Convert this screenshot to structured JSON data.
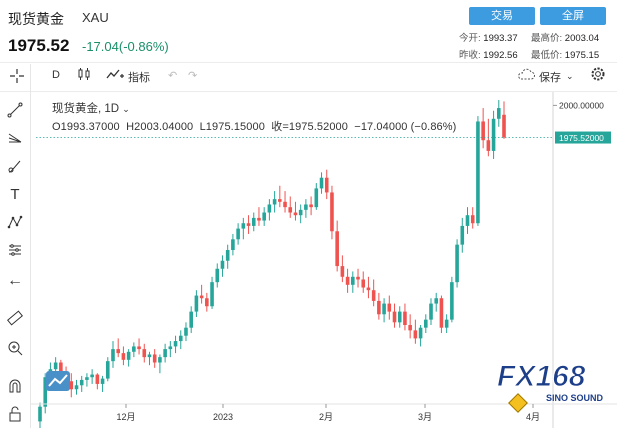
{
  "header": {
    "title": "现货黄金",
    "symbol": "XAU",
    "price": "1975.52",
    "change": "-17.04(-0.86%)",
    "trade_button": "交易",
    "fullscreen_button": "全屏",
    "stats": [
      {
        "label": "今开:",
        "value": "1993.37"
      },
      {
        "label": "最高价:",
        "value": "2003.04"
      },
      {
        "label": "昨收:",
        "value": "1992.56"
      },
      {
        "label": "最低价:",
        "value": "1975.15"
      }
    ]
  },
  "toolbar": {
    "interval": "D",
    "indicators_label": "指标",
    "save_label": "保存"
  },
  "legend": {
    "line1": "现货黄金, 1D",
    "open": "O1993.37000",
    "high": "H2003.04000",
    "low": "L1975.15000",
    "close": "收=1975.52000",
    "change": "−17.04000 (−0.86%)"
  },
  "watermark": {
    "brand": "FX168",
    "sub": "SINO SOUND"
  },
  "chart_data": {
    "type": "candlestick",
    "interval": "1D",
    "symbol": "XAU",
    "ylim": [
      1780,
      2010
    ],
    "y_ticks": [
      "2000.00000"
    ],
    "last_price_label": "1975.52000",
    "x_ticks": [
      "12月",
      "2023",
      "2月",
      "3月",
      "4月"
    ],
    "candles": [
      [
        1764,
        1778,
        1752,
        1775
      ],
      [
        1775,
        1800,
        1770,
        1797
      ],
      [
        1797,
        1808,
        1790,
        1803
      ],
      [
        1803,
        1812,
        1798,
        1808
      ],
      [
        1808,
        1810,
        1796,
        1801
      ],
      [
        1801,
        1805,
        1790,
        1794
      ],
      [
        1794,
        1800,
        1782,
        1788
      ],
      [
        1788,
        1795,
        1784,
        1791
      ],
      [
        1791,
        1798,
        1786,
        1795
      ],
      [
        1795,
        1800,
        1790,
        1797
      ],
      [
        1797,
        1803,
        1792,
        1799
      ],
      [
        1799,
        1800,
        1788,
        1792
      ],
      [
        1792,
        1798,
        1786,
        1796
      ],
      [
        1796,
        1812,
        1794,
        1809
      ],
      [
        1809,
        1824,
        1804,
        1818
      ],
      [
        1818,
        1826,
        1812,
        1815
      ],
      [
        1815,
        1820,
        1806,
        1810
      ],
      [
        1810,
        1818,
        1805,
        1816
      ],
      [
        1816,
        1823,
        1812,
        1820
      ],
      [
        1820,
        1826,
        1814,
        1818
      ],
      [
        1818,
        1822,
        1808,
        1812
      ],
      [
        1812,
        1816,
        1806,
        1814
      ],
      [
        1814,
        1818,
        1804,
        1808
      ],
      [
        1808,
        1814,
        1800,
        1812
      ],
      [
        1812,
        1822,
        1808,
        1818
      ],
      [
        1818,
        1824,
        1812,
        1820
      ],
      [
        1820,
        1828,
        1815,
        1824
      ],
      [
        1824,
        1832,
        1818,
        1828
      ],
      [
        1828,
        1838,
        1824,
        1834
      ],
      [
        1834,
        1850,
        1830,
        1846
      ],
      [
        1846,
        1862,
        1842,
        1858
      ],
      [
        1858,
        1866,
        1852,
        1856
      ],
      [
        1856,
        1860,
        1846,
        1850
      ],
      [
        1850,
        1872,
        1848,
        1868
      ],
      [
        1868,
        1882,
        1864,
        1878
      ],
      [
        1878,
        1888,
        1872,
        1884
      ],
      [
        1884,
        1896,
        1878,
        1892
      ],
      [
        1892,
        1904,
        1888,
        1900
      ],
      [
        1900,
        1912,
        1896,
        1908
      ],
      [
        1908,
        1916,
        1900,
        1912
      ],
      [
        1912,
        1918,
        1904,
        1910
      ],
      [
        1910,
        1920,
        1906,
        1916
      ],
      [
        1916,
        1924,
        1910,
        1914
      ],
      [
        1914,
        1924,
        1910,
        1920
      ],
      [
        1920,
        1930,
        1914,
        1926
      ],
      [
        1926,
        1936,
        1920,
        1930
      ],
      [
        1930,
        1940,
        1924,
        1928
      ],
      [
        1928,
        1936,
        1920,
        1924
      ],
      [
        1924,
        1932,
        1916,
        1920
      ],
      [
        1920,
        1928,
        1914,
        1918
      ],
      [
        1918,
        1926,
        1912,
        1922
      ],
      [
        1922,
        1930,
        1916,
        1926
      ],
      [
        1926,
        1932,
        1918,
        1924
      ],
      [
        1924,
        1942,
        1922,
        1938
      ],
      [
        1938,
        1950,
        1934,
        1946
      ],
      [
        1946,
        1952,
        1930,
        1935
      ],
      [
        1935,
        1940,
        1900,
        1906
      ],
      [
        1906,
        1914,
        1876,
        1880
      ],
      [
        1880,
        1888,
        1868,
        1872
      ],
      [
        1872,
        1878,
        1860,
        1866
      ],
      [
        1866,
        1876,
        1860,
        1872
      ],
      [
        1872,
        1878,
        1864,
        1870
      ],
      [
        1870,
        1876,
        1860,
        1864
      ],
      [
        1864,
        1872,
        1856,
        1862
      ],
      [
        1862,
        1870,
        1850,
        1854
      ],
      [
        1854,
        1860,
        1840,
        1844
      ],
      [
        1844,
        1856,
        1838,
        1852
      ],
      [
        1852,
        1858,
        1840,
        1846
      ],
      [
        1846,
        1852,
        1834,
        1838
      ],
      [
        1838,
        1850,
        1834,
        1846
      ],
      [
        1846,
        1852,
        1832,
        1836
      ],
      [
        1836,
        1844,
        1826,
        1832
      ],
      [
        1832,
        1840,
        1822,
        1826
      ],
      [
        1826,
        1836,
        1820,
        1834
      ],
      [
        1834,
        1844,
        1830,
        1840
      ],
      [
        1840,
        1856,
        1836,
        1852
      ],
      [
        1852,
        1860,
        1846,
        1856
      ],
      [
        1856,
        1858,
        1830,
        1834
      ],
      [
        1834,
        1844,
        1830,
        1840
      ],
      [
        1840,
        1872,
        1838,
        1868
      ],
      [
        1868,
        1900,
        1864,
        1896
      ],
      [
        1896,
        1916,
        1890,
        1910
      ],
      [
        1910,
        1924,
        1904,
        1918
      ],
      [
        1918,
        1924,
        1908,
        1912
      ],
      [
        1912,
        1992,
        1910,
        1988
      ],
      [
        1988,
        1998,
        1968,
        1974
      ],
      [
        1974,
        1990,
        1962,
        1966
      ],
      [
        1966,
        1996,
        1960,
        1990
      ],
      [
        1990,
        2004,
        1984,
        1998
      ],
      [
        1993,
        2003,
        1975,
        1976
      ]
    ]
  }
}
